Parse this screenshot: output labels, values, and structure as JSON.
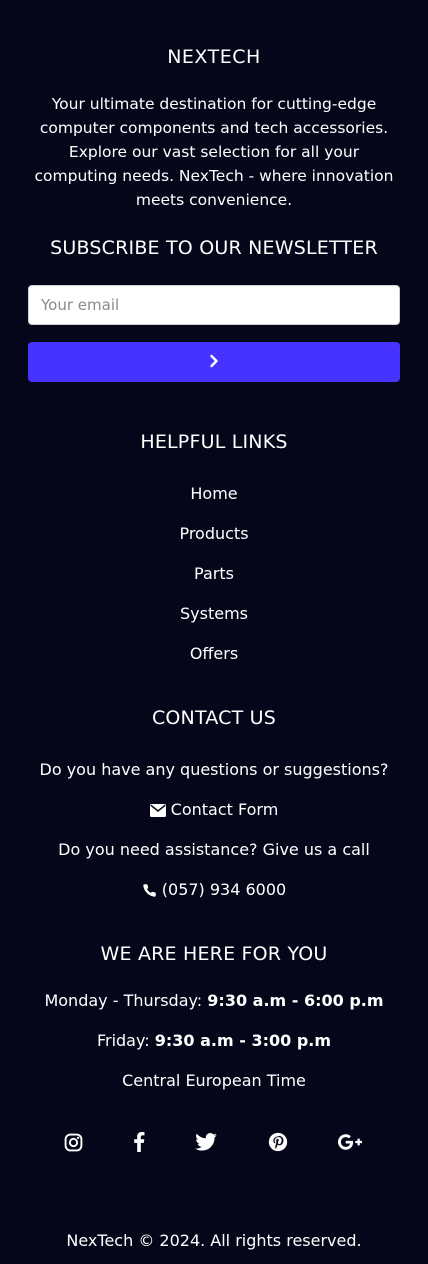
{
  "brand": {
    "name": "NEXTECH",
    "description": "Your ultimate destination for cutting-edge computer components and tech accessories. Explore our vast selection for all your computing needs. NexTech - where innovation meets convenience."
  },
  "newsletter": {
    "heading": "SUBSCRIBE TO OUR NEWSLETTER",
    "email_placeholder": "Your email",
    "email_value": "",
    "submit_icon": "chevron-right-icon"
  },
  "links": {
    "heading": "HELPFUL LINKS",
    "items": [
      {
        "label": "Home"
      },
      {
        "label": "Products"
      },
      {
        "label": "Parts"
      },
      {
        "label": "Systems"
      },
      {
        "label": "Offers"
      }
    ]
  },
  "contact": {
    "heading": "CONTACT US",
    "questions_text": "Do you have any questions or suggestions?",
    "form_label": "Contact Form",
    "form_icon": "envelope-icon",
    "assist_text": "Do you need assistance? Give us a call",
    "phone": "(057) 934 6000",
    "phone_icon": "phone-icon"
  },
  "hours": {
    "heading": "WE ARE HERE FOR YOU",
    "weekday_label": "Monday - Thursday:",
    "weekday_time": "9:30 a.m - 6:00 p.m",
    "friday_label": "Friday:",
    "friday_time": "9:30 a.m - 3:00 p.m",
    "timezone": "Central European Time"
  },
  "social": [
    "instagram-icon",
    "facebook-icon",
    "twitter-icon",
    "pinterest-icon",
    "google-plus-icon"
  ],
  "copyright": "NexTech © 2024. All rights reserved.",
  "colors": {
    "background": "#06061a",
    "accent": "#4733ff",
    "text": "#ffffff"
  }
}
